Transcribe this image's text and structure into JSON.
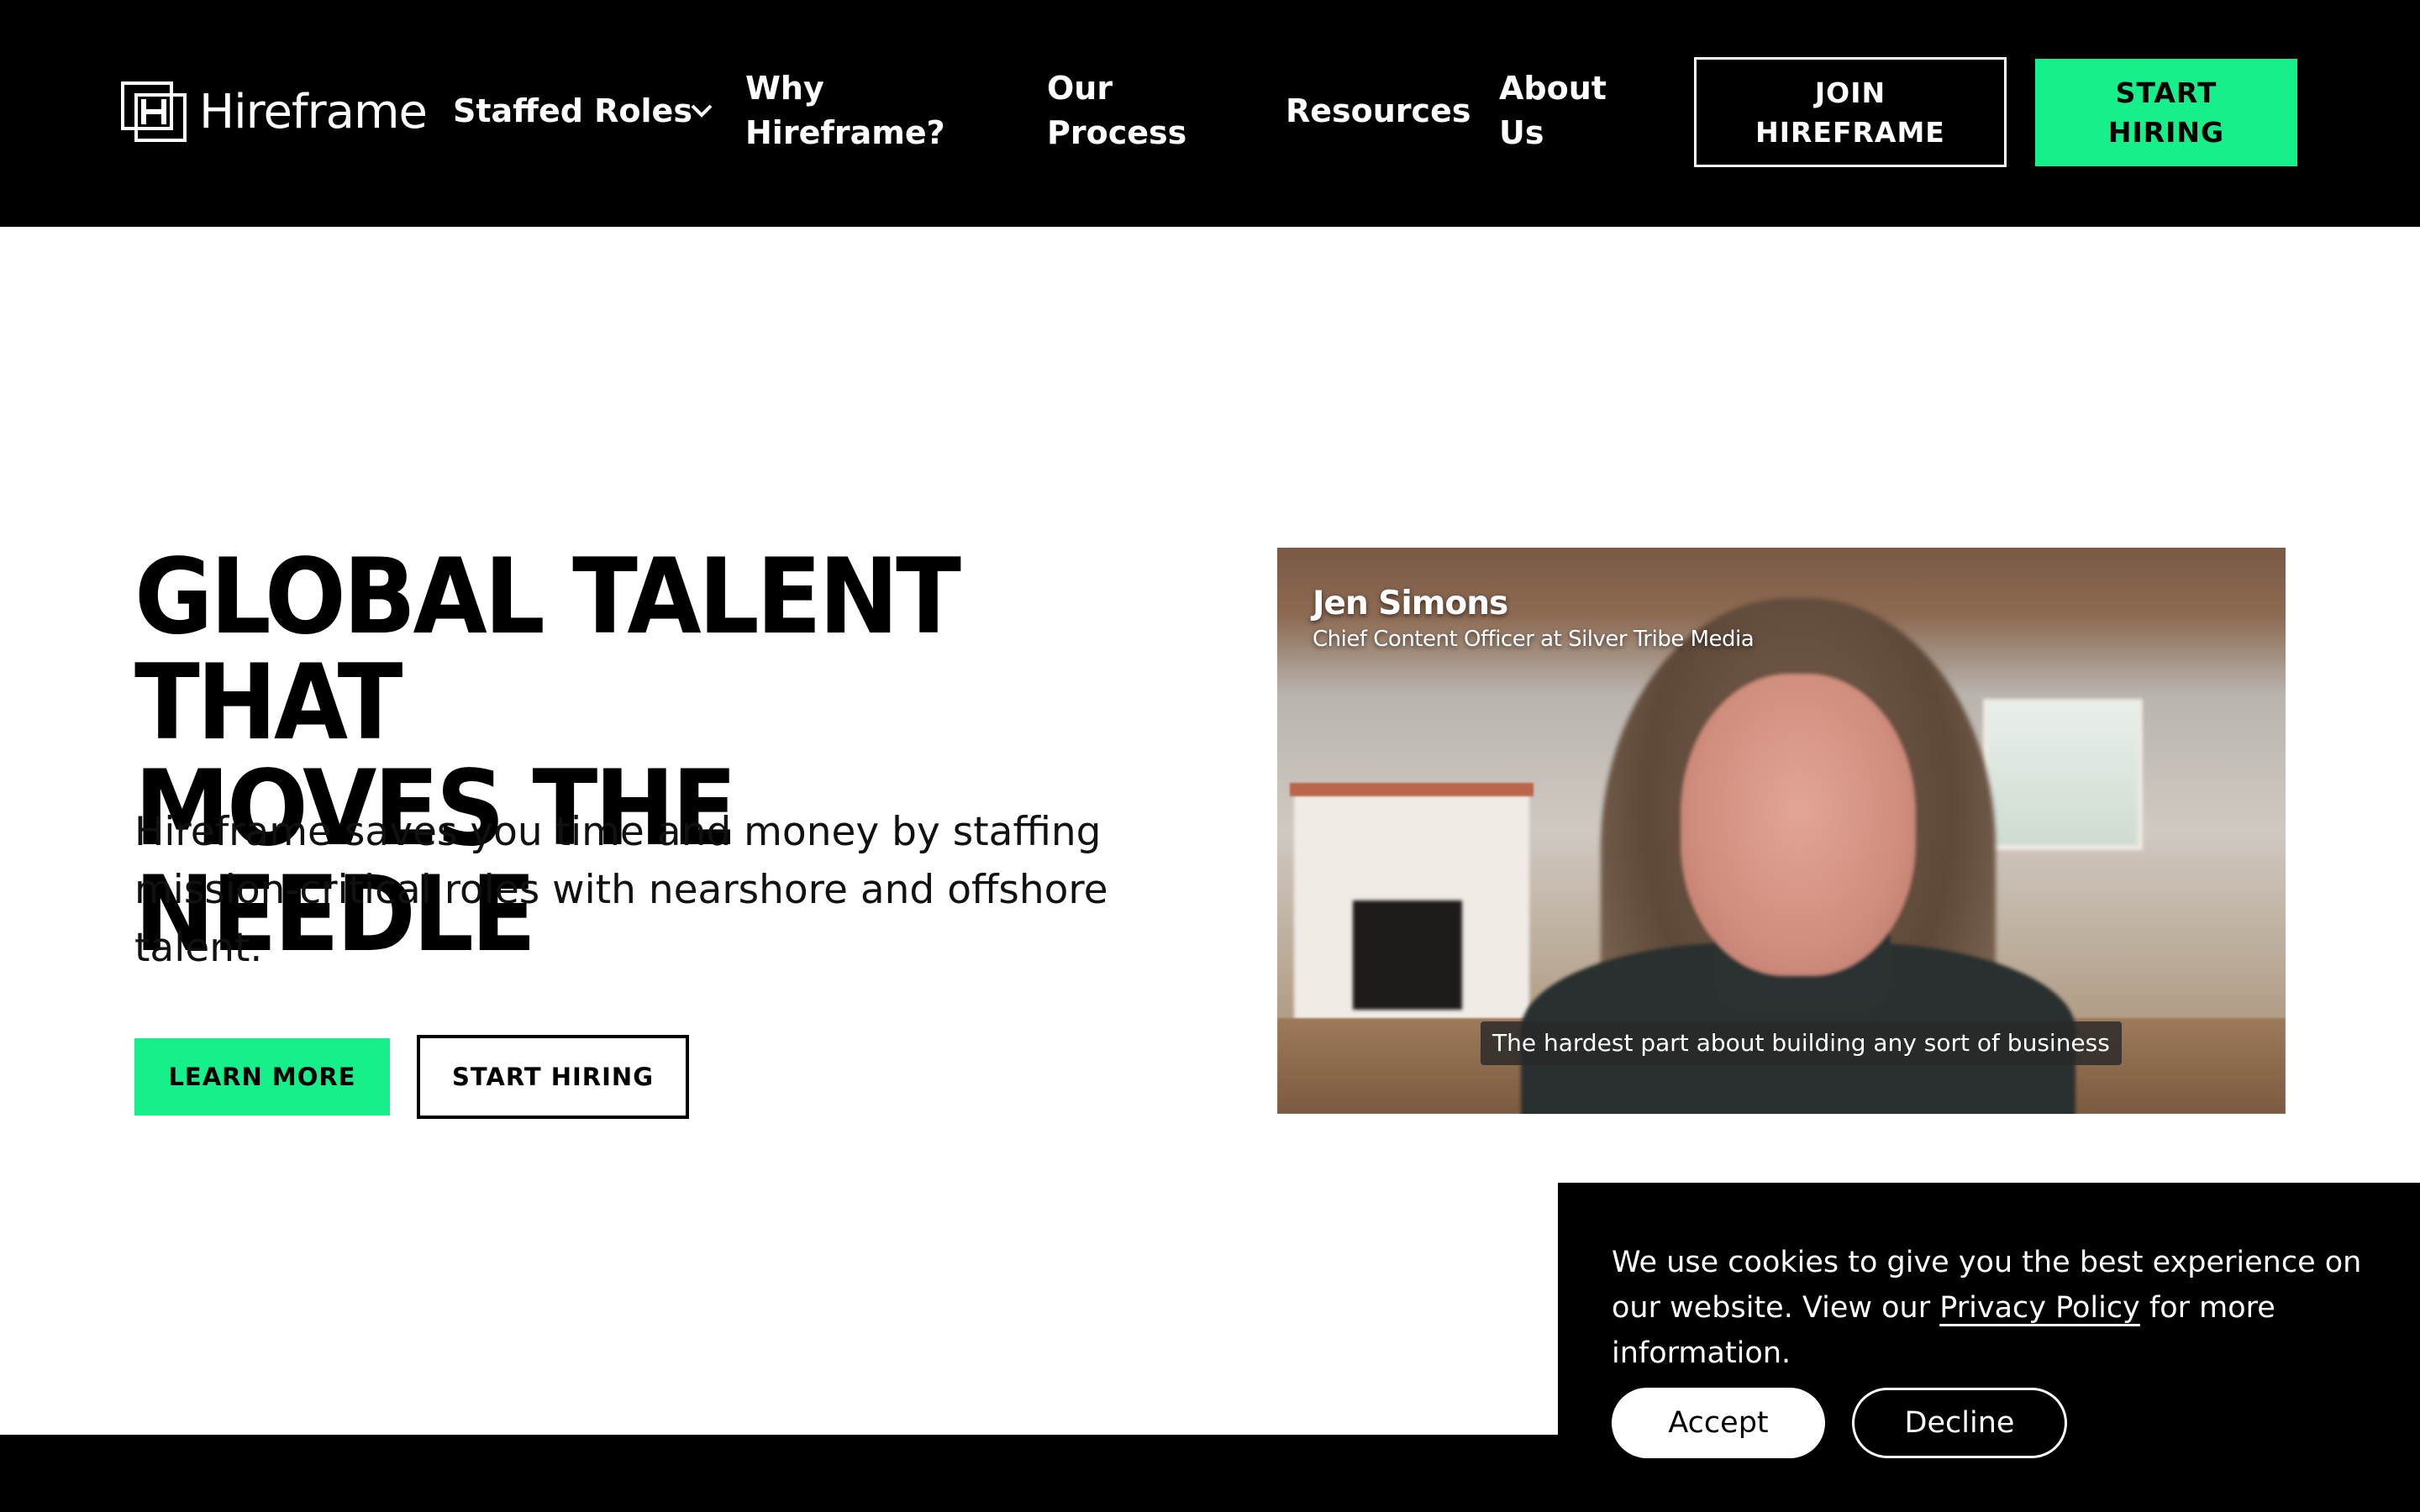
{
  "brand": {
    "name": "Hireframe",
    "accent_color": "#15f08a",
    "logo_icon": "hireframe-logo-icon"
  },
  "nav": {
    "items": [
      {
        "label_lines": [
          "Staffed Roles"
        ],
        "has_dropdown": true
      },
      {
        "label_lines": [
          "Why",
          "Hireframe?"
        ]
      },
      {
        "label_lines": [
          "Our",
          "Process"
        ]
      },
      {
        "label_lines": [
          "Resources"
        ]
      },
      {
        "label_lines": [
          "About",
          "Us"
        ]
      }
    ],
    "join_button": {
      "label_lines": [
        "JOIN",
        "HIREFRAME"
      ]
    },
    "start_button": {
      "label_lines": [
        "START",
        "HIRING"
      ]
    },
    "dropdown_icon": "chevron-down-icon"
  },
  "hero": {
    "headline_lines": [
      "GLOBAL TALENT THAT",
      "MOVES THE NEEDLE"
    ],
    "subtext": "Hireframe saves you time and money by staffing mission-critical roles with nearshore and offshore talent.",
    "learn_more_label": "LEARN MORE",
    "start_hiring_label": "START HIRING"
  },
  "video": {
    "speaker_name": "Jen Simons",
    "speaker_title": "Chief Content Officer at Silver Tribe Media",
    "caption": "The hardest part about building any sort of business"
  },
  "cookie_banner": {
    "text_before": "We use cookies to give you the best experience on our website. View our ",
    "link_label": "Privacy Policy",
    "text_after": " for more information.",
    "accept_label": "Accept",
    "decline_label": "Decline"
  }
}
